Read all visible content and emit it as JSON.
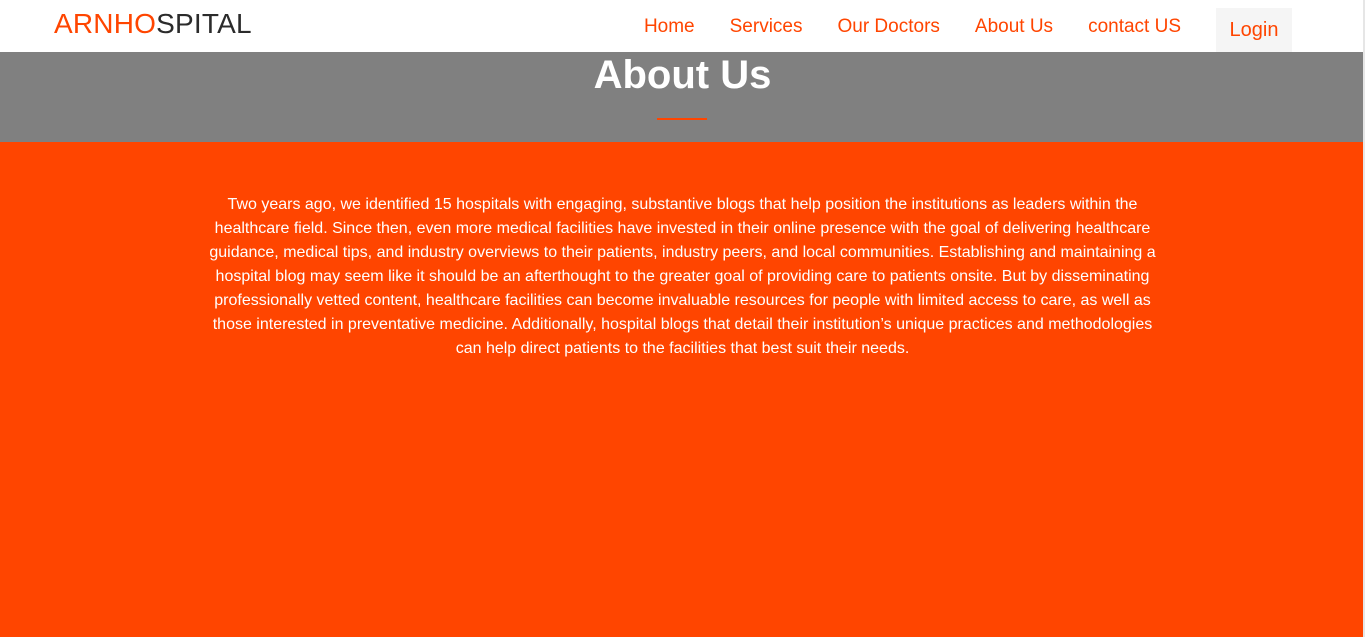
{
  "navbar": {
    "brand_part1": "ARNHO",
    "brand_part2": "SPITAL",
    "links": [
      {
        "label": "Home"
      },
      {
        "label": "Services"
      },
      {
        "label": "Our Doctors"
      },
      {
        "label": "About Us"
      },
      {
        "label": "contact US"
      }
    ],
    "login_label": "Login"
  },
  "hero": {
    "title": "About Us"
  },
  "content": {
    "paragraph": "Two years ago, we identified 15 hospitals with engaging, substantive blogs that help position the institutions as leaders within the healthcare field. Since then, even more medical facilities have invested in their online presence with the goal of delivering healthcare guidance, medical tips, and industry overviews to their patients, industry peers, and local communities. Establishing and maintaining a hospital blog may seem like it should be an afterthought to the greater goal of providing care to patients onsite. But by disseminating professionally vetted content, healthcare facilities can become invaluable resources for people with limited access to care, as well as those interested in preventative medicine. Additionally, hospital blogs that detail their institution’s unique practices and methodologies can help direct patients to the facilities that best suit their needs."
  },
  "colors": {
    "accent": "#ff4500",
    "hero_background": "#808080",
    "navbar_background": "#ffffff",
    "login_background": "#f5f5f5",
    "brand_dark": "#2b2b2b"
  }
}
